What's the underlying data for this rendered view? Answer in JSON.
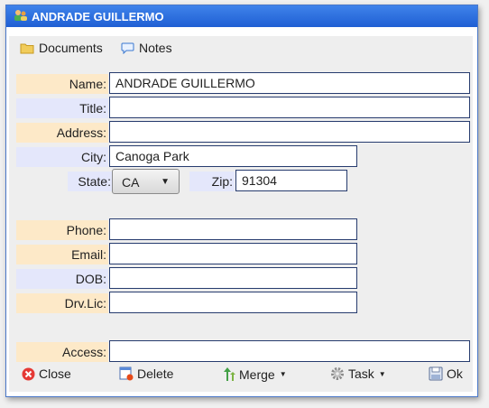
{
  "window": {
    "title": "ANDRADE GUILLERMO"
  },
  "toolbar": {
    "documents": "Documents",
    "notes": "Notes"
  },
  "form": {
    "name_label": "Name:",
    "name_value": "ANDRADE GUILLERMO",
    "title_label": "Title:",
    "title_value": "",
    "address_label": "Address:",
    "address_value": "",
    "city_label": "City:",
    "city_value": "Canoga Park",
    "state_label": "State:",
    "state_value": "CA",
    "zip_label": "Zip:",
    "zip_value": "91304",
    "phone_label": "Phone:",
    "phone_value": "",
    "email_label": "Email:",
    "email_value": "",
    "dob_label": "DOB:",
    "dob_value": "",
    "drvlic_label": "Drv.Lic:",
    "drvlic_value": "",
    "access_label": "Access:",
    "access_value": ""
  },
  "buttons": {
    "close": "Close",
    "delete": "Delete",
    "merge": "Merge",
    "task": "Task",
    "ok": "Ok"
  },
  "icons": {
    "title": "people-icon",
    "documents": "folder-icon",
    "notes": "speech-bubble-icon",
    "close": "red-x-circle-icon",
    "delete": "delete-doc-icon",
    "merge": "green-arrows-icon",
    "task": "gear-icon",
    "ok": "save-icon"
  },
  "colors": {
    "titlebar": "#2a6fe0",
    "label_orange": "#fde9c8",
    "label_blue": "#e4e7fb"
  }
}
